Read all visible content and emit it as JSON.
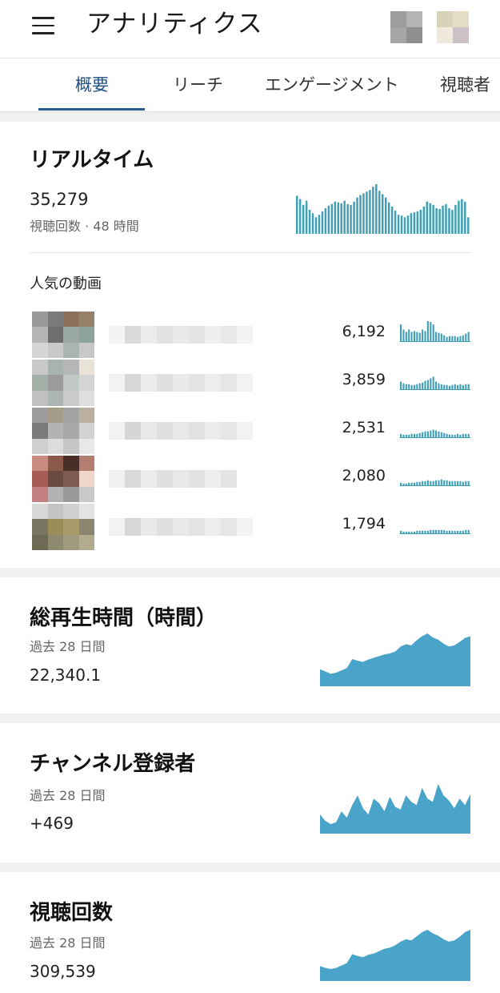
{
  "header": {
    "title": "アナリティクス",
    "menu_icon": "hamburger-menu-icon"
  },
  "tabs": [
    {
      "label": "概要",
      "active": true
    },
    {
      "label": "リーチ",
      "active": false
    },
    {
      "label": "エンゲージメント",
      "active": false
    },
    {
      "label": "視聴者",
      "active": false
    }
  ],
  "realtime": {
    "title": "リアルタイム",
    "value": "35,279",
    "subtitle": "視聴回数 · 48 時間",
    "chart_values": [
      46,
      42,
      35,
      40,
      29,
      25,
      20,
      23,
      27,
      31,
      34,
      36,
      39,
      38,
      37,
      40,
      36,
      35,
      39,
      44,
      47,
      49,
      51,
      53,
      57,
      60,
      52,
      48,
      44,
      38,
      33,
      28,
      23,
      22,
      20,
      22,
      25,
      26,
      27,
      29,
      33,
      39,
      37,
      35,
      31,
      30,
      34,
      36,
      31,
      29,
      35,
      40,
      42,
      39,
      20
    ],
    "popular_label": "人気の動画",
    "videos": [
      {
        "count": "6,192",
        "chart_values": [
          21,
          15,
          12,
          15,
          12,
          13,
          12,
          11,
          15,
          13,
          25,
          24,
          21,
          12,
          11,
          10,
          8,
          6,
          7,
          7,
          7,
          6,
          7,
          8,
          10,
          12
        ]
      },
      {
        "count": "3,859",
        "chart_values": [
          10,
          8,
          7,
          7,
          6,
          6,
          7,
          8,
          9,
          11,
          12,
          14,
          16,
          10,
          8,
          7,
          6,
          6,
          5,
          6,
          7,
          6,
          7,
          6,
          7,
          7
        ]
      },
      {
        "count": "2,531",
        "chart_values": [
          5,
          4,
          4,
          4,
          5,
          5,
          5,
          6,
          7,
          8,
          8,
          9,
          10,
          9,
          8,
          7,
          6,
          5,
          4,
          4,
          4,
          5,
          4,
          5,
          5,
          5
        ]
      },
      {
        "count": "2,080",
        "chart_values": [
          4,
          3,
          3,
          4,
          4,
          4,
          5,
          5,
          6,
          6,
          7,
          6,
          6,
          7,
          7,
          8,
          7,
          7,
          6,
          6,
          6,
          6,
          6,
          5,
          6,
          6
        ]
      },
      {
        "count": "1,794",
        "chart_values": [
          4,
          3,
          3,
          3,
          3,
          3,
          4,
          4,
          4,
          4,
          4,
          5,
          5,
          5,
          5,
          5,
          5,
          4,
          4,
          4,
          4,
          4,
          4,
          4,
          5,
          5
        ]
      }
    ]
  },
  "watch_time": {
    "title": "総再生時間（時間）",
    "period": "過去 28 日間",
    "value": "22,340.1",
    "chart_values": [
      30,
      26,
      22,
      24,
      28,
      32,
      48,
      45,
      43,
      47,
      50,
      53,
      56,
      58,
      61,
      70,
      74,
      72,
      81,
      88,
      93,
      86,
      82,
      75,
      70,
      72,
      78,
      85,
      88
    ]
  },
  "subscribers": {
    "title": "チャンネル登録者",
    "period": "過去 28 日間",
    "value": "+469",
    "chart_values": [
      30,
      20,
      15,
      18,
      35,
      25,
      45,
      60,
      40,
      30,
      55,
      48,
      35,
      58,
      42,
      38,
      60,
      50,
      45,
      72,
      55,
      50,
      78,
      60,
      52,
      40,
      55,
      45,
      62
    ]
  },
  "views": {
    "title": "視聴回数",
    "period": "過去 28 日間",
    "value": "309,539",
    "chart_values": [
      25,
      22,
      20,
      22,
      26,
      30,
      45,
      42,
      40,
      44,
      46,
      50,
      54,
      56,
      60,
      66,
      70,
      68,
      75,
      82,
      86,
      80,
      76,
      70,
      66,
      68,
      74,
      82,
      86
    ]
  },
  "colors": {
    "accent_tab": "#1f4f82",
    "bar_chart": "#3f9fb5",
    "area_chart": "#4aa3c8"
  }
}
